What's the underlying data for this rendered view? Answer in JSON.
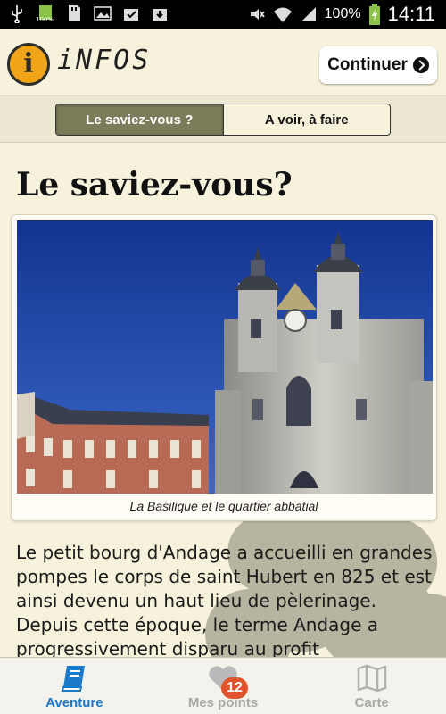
{
  "status_bar": {
    "battery_percent": "100%",
    "time": "14:11",
    "mini_label": "100%"
  },
  "header": {
    "title": "iNFOS",
    "continue_label": "Continuer"
  },
  "tabs": [
    {
      "label": "Le saviez-vous ?",
      "active": true
    },
    {
      "label": "A voir, à faire",
      "active": false
    }
  ],
  "main": {
    "heading": "Le saviez-vous?",
    "image_caption": "La Basilique et le quartier abbatial",
    "body": "Le petit bourg d'Andage a accueilli en grandes pompes le corps de saint Hubert en 825 et est ainsi devenu un haut lieu de pèlerinage. Depuis cette époque, le terme Andage a progressivement disparu au profit"
  },
  "bottom_nav": [
    {
      "label": "Aventure",
      "icon": "book-icon",
      "active": true
    },
    {
      "label": "Mes points",
      "icon": "heart-icon",
      "badge": "12",
      "active": false
    },
    {
      "label": "Carte",
      "icon": "map-icon",
      "active": false
    }
  ],
  "colors": {
    "accent": "#1b79c9",
    "tab_active": "#7c7c5a",
    "background": "#f7f2dc",
    "badge": "#e2532f",
    "logo": "#f0a417"
  }
}
